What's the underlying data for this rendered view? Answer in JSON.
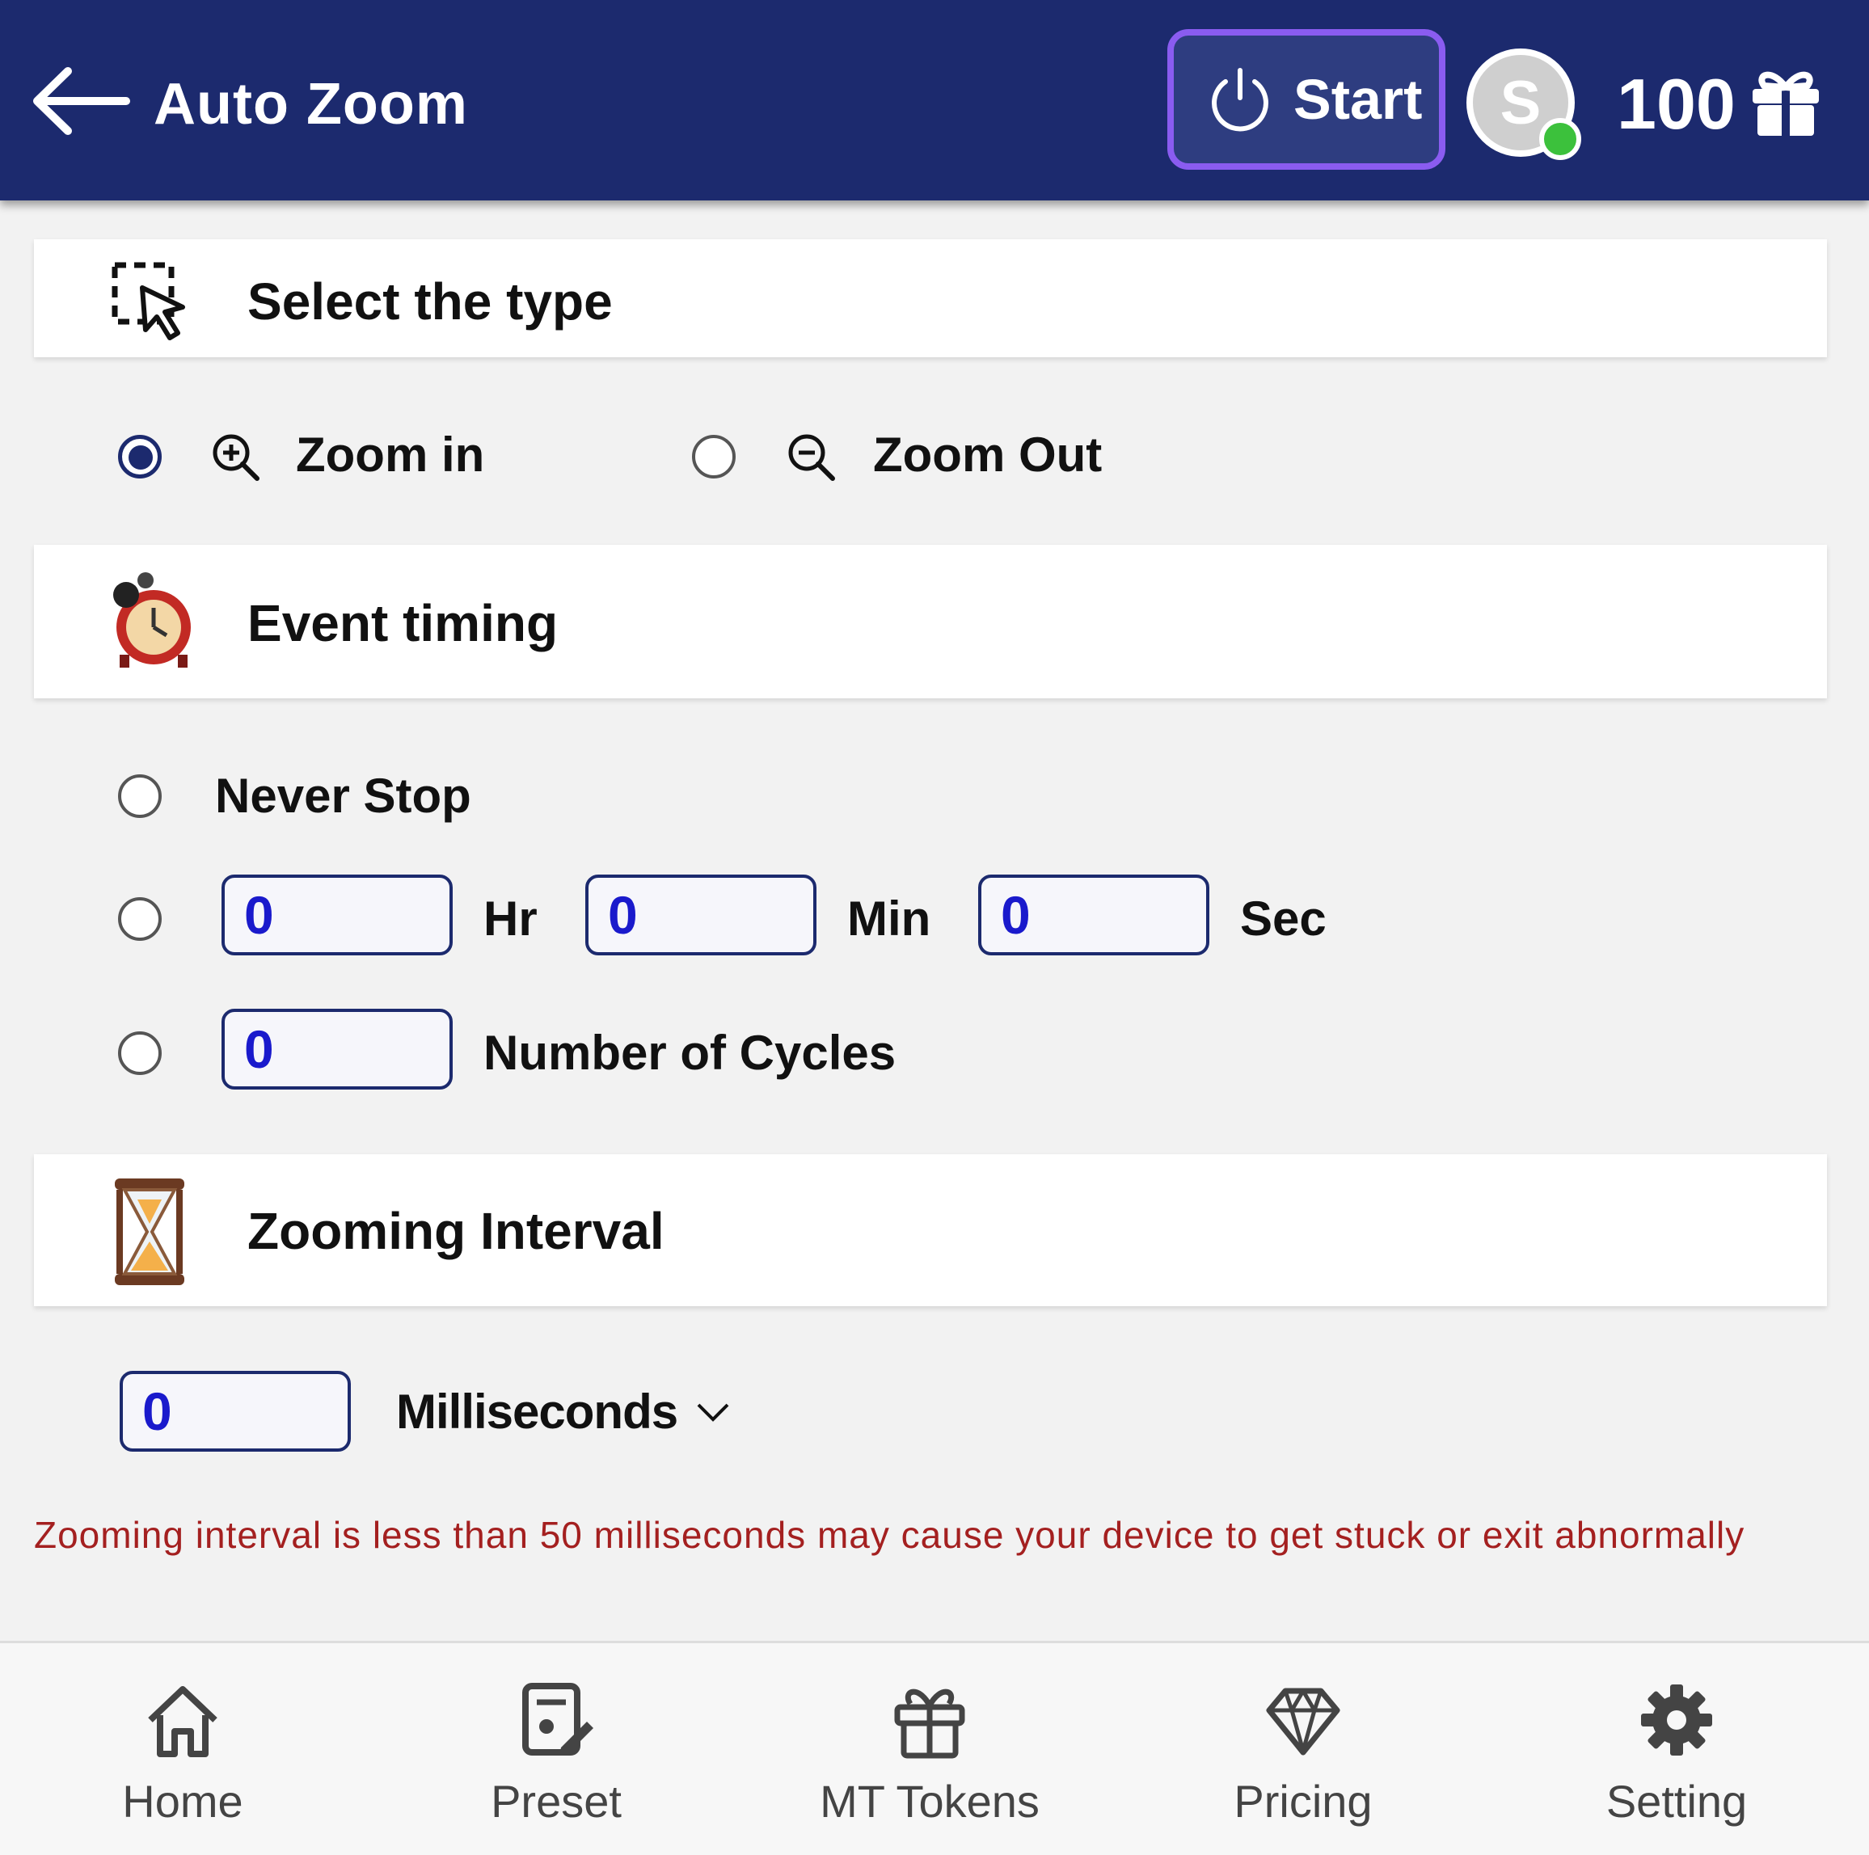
{
  "header": {
    "title": "Auto Zoom",
    "start_label": "Start",
    "avatar_initial": "S",
    "token_count": "100"
  },
  "select_type": {
    "title": "Select the type",
    "options": [
      {
        "label": "Zoom in",
        "checked": true
      },
      {
        "label": "Zoom Out",
        "checked": false
      }
    ]
  },
  "event_timing": {
    "title": "Event timing",
    "never_stop_label": "Never Stop",
    "hr_value": "0",
    "hr_label": "Hr",
    "min_value": "0",
    "min_label": "Min",
    "sec_value": "0",
    "sec_label": "Sec",
    "cycles_value": "0",
    "cycles_label": "Number of Cycles"
  },
  "zooming_interval": {
    "title": "Zooming Interval",
    "value": "0",
    "unit": "Milliseconds",
    "warning": "Zooming interval is less than 50 milliseconds may cause your device to get stuck or exit abnormally"
  },
  "bottom_nav": {
    "items": [
      {
        "label": "Home",
        "icon": "home-icon"
      },
      {
        "label": "Preset",
        "icon": "preset-icon"
      },
      {
        "label": "MT Tokens",
        "icon": "gift-icon"
      },
      {
        "label": "Pricing",
        "icon": "diamond-icon"
      },
      {
        "label": "Setting",
        "icon": "gear-icon"
      }
    ]
  },
  "colors": {
    "header_bg": "#1c2a6e",
    "start_border": "#8a5cf0",
    "input_text": "#1a1acc",
    "warning_text": "#a42020",
    "online": "#3cc13c"
  }
}
